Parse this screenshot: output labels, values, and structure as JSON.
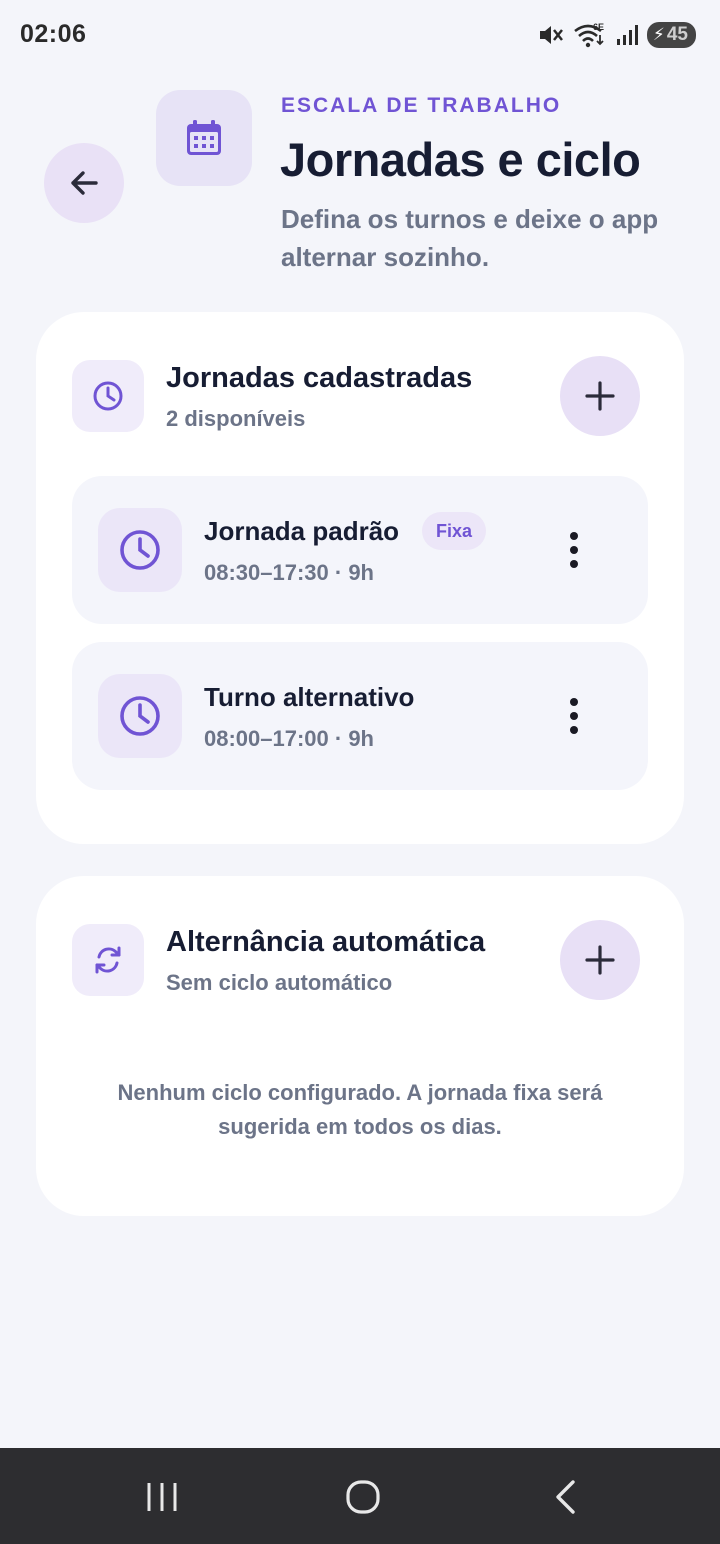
{
  "status_bar": {
    "time": "02:06",
    "network_label": "6E",
    "battery": "45",
    "icons": [
      "mute-icon",
      "wifi-icon",
      "signal-icon",
      "battery-charging-icon"
    ]
  },
  "header": {
    "eyebrow": "ESCALA DE TRABALHO",
    "title": "Jornadas e ciclo",
    "subtitle": "Defina os turnos e deixe o app alternar sozinho.",
    "back_icon": "arrow-left-icon",
    "header_icon": "calendar-icon"
  },
  "shifts_section": {
    "title": "Jornadas cadastradas",
    "subtitle": "2 disponíveis",
    "icon": "clock-icon",
    "items": [
      {
        "name": "Jornada padrão",
        "badge": "Fixa",
        "time": "08:30–17:30 · 9h"
      },
      {
        "name": "Turno alternativo",
        "badge": "",
        "time": "08:00–17:00 · 9h"
      }
    ]
  },
  "rotation_section": {
    "title": "Alternância automática",
    "subtitle": "Sem ciclo automático",
    "icon": "refresh-icon",
    "empty_message": "Nenhum ciclo configurado. A jornada fixa será sugerida em todos os dias."
  },
  "nav_bar": {
    "icons": [
      "recent-apps-icon",
      "home-icon",
      "back-icon"
    ]
  },
  "colors": {
    "accent": "#7054d4",
    "background": "#f4f5fa",
    "card": "#ffffff",
    "title": "#171d33",
    "muted": "#6c7488"
  }
}
